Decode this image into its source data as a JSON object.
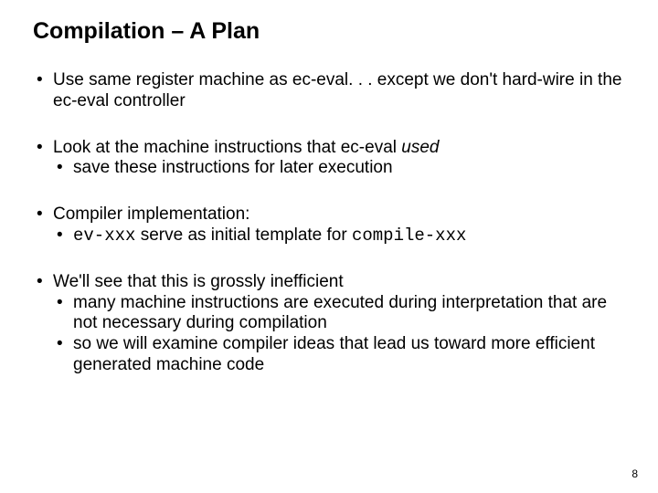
{
  "title": "Compilation – A Plan",
  "bullets": {
    "b1": "Use same register machine as ec-eval. . . except we don't hard-wire in the ec-eval controller",
    "b2_pre": "Look at the machine instructions that ec-eval ",
    "b2_italic": "used",
    "b2_sub1": "save these instructions for later execution",
    "b3": "Compiler implementation:",
    "b3_sub1_mono1": "ev-xxx",
    "b3_sub1_mid": " serve as initial template for ",
    "b3_sub1_mono2": "compile-xxx",
    "b4": "We'll see that this is grossly inefficient",
    "b4_sub1": "many machine instructions are executed during interpretation that are not necessary during compilation",
    "b4_sub2": "so we will examine compiler ideas that lead us toward more efficient generated machine code"
  },
  "page_number": "8"
}
